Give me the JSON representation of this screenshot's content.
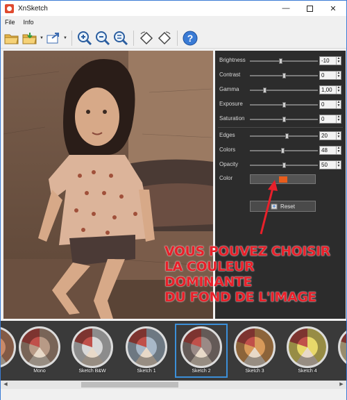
{
  "window": {
    "title": "XnSketch"
  },
  "menu": [
    {
      "label": "File"
    },
    {
      "label": "Info"
    }
  ],
  "toolbar": {
    "buttons": [
      {
        "icon": "open-folder-icon"
      },
      {
        "icon": "save-folder-icon"
      },
      {
        "icon": "export-icon"
      },
      {
        "icon": "zoom-in-icon"
      },
      {
        "icon": "zoom-out-icon"
      },
      {
        "icon": "zoom-fit-icon"
      },
      {
        "icon": "rotate-left-icon"
      },
      {
        "icon": "rotate-right-icon"
      },
      {
        "icon": "help-icon"
      }
    ]
  },
  "panel": {
    "sliders": [
      {
        "label": "Brightness",
        "value": "-10",
        "level": 0.45
      },
      {
        "label": "Contrast",
        "value": "0",
        "level": 0.5
      },
      {
        "label": "Gamma",
        "value": "1,00",
        "level": 0.2
      },
      {
        "label": "Exposure",
        "value": "0",
        "level": 0.5
      },
      {
        "label": "Saturation",
        "value": "0",
        "level": 0.5
      },
      {
        "label": "Edges",
        "value": "20",
        "level": 0.55
      },
      {
        "label": "Colors",
        "value": "48",
        "level": 0.48
      },
      {
        "label": "Opacity",
        "value": "50",
        "level": 0.5
      }
    ],
    "color_label": "Color",
    "color_value": "#e85d1c",
    "reset_label": "Reset"
  },
  "annotation": {
    "line1": "VOUS POUVEZ CHOISIR",
    "line2": "LA COULEUR DOMINANTE",
    "line3": "DU FOND DE L'IMAGE"
  },
  "filmstrip": [
    {
      "label": "",
      "tone": "#c98a6a"
    },
    {
      "label": "Mono",
      "tone": "#b89a86"
    },
    {
      "label": "Sketch B&W",
      "tone": "#d8d8d8"
    },
    {
      "label": "Sketch 1",
      "tone": "#a8b8c8"
    },
    {
      "label": "Sketch 2",
      "tone": "#9a8a86",
      "selected": true
    },
    {
      "label": "Sketch 3",
      "tone": "#d89a5a"
    },
    {
      "label": "Sketch 4",
      "tone": "#e8d86a"
    },
    {
      "label": "",
      "tone": "#ead8a8"
    }
  ],
  "colors": {
    "accent": "#3b8fd9",
    "annotation": "#e8202a"
  }
}
